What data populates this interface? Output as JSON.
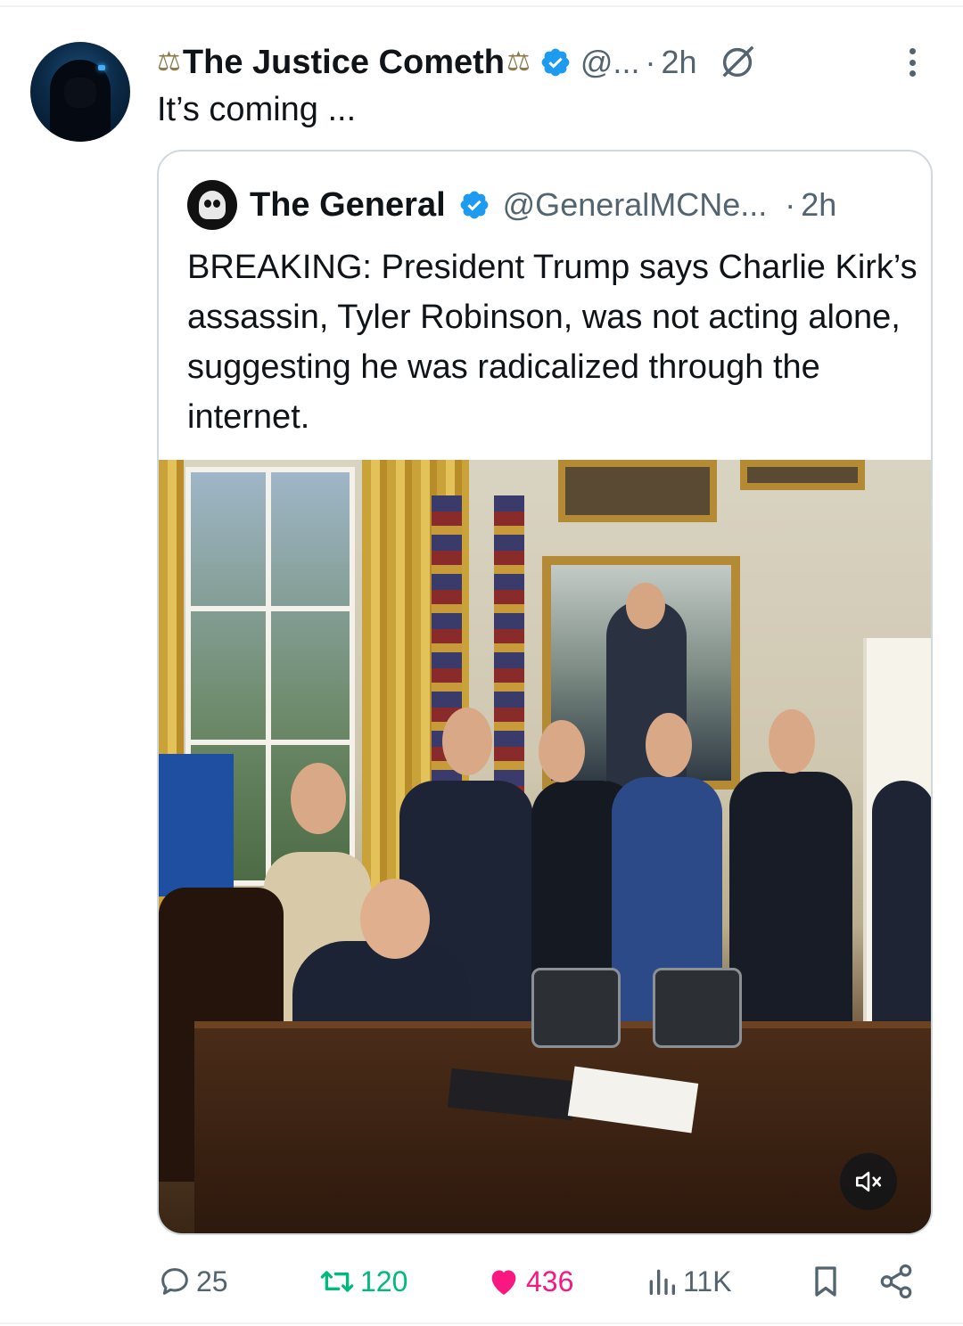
{
  "post": {
    "display_name": "The Justice Cometh",
    "handle": "@...",
    "time": "2h",
    "text": "It’s coming ...",
    "scale_glyph": "⚖",
    "icons": {
      "avatar": "hooded-figure-avatar",
      "verified": "verified-badge-icon",
      "grok": "grok-icon",
      "more": "more-options-icon"
    }
  },
  "quote": {
    "display_name": "The General",
    "handle": "@GeneralMCNe...",
    "time": "2h",
    "text": "BREAKING: President Trump says Charlie Kirk’s assassin, Tyler Robinson, was not acting alone, suggesting he was radicalized through the internet.",
    "media": {
      "type": "video",
      "muted": true
    }
  },
  "actions": {
    "reply_count": "25",
    "repost_count": "120",
    "like_count": "436",
    "view_count": "11K"
  },
  "colors": {
    "text": "#0f1419",
    "secondary": "#536471",
    "verified": "#1d9bf0",
    "repost": "#00ba7c",
    "like": "#f91880",
    "border": "#cfd9de"
  }
}
